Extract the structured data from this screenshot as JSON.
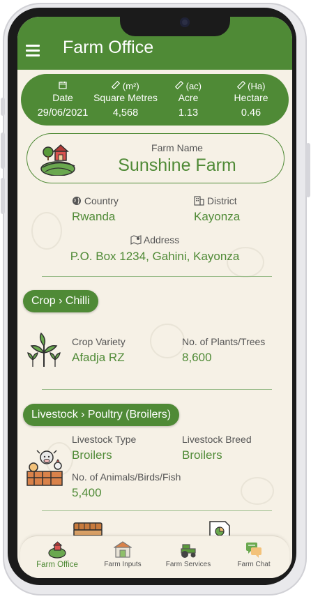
{
  "app": {
    "title": "Farm Office"
  },
  "stats": [
    {
      "icon": "calendar-icon",
      "unit": "",
      "label": "Date",
      "value": "29/06/2021"
    },
    {
      "icon": "ruler-icon",
      "unit": "(m²)",
      "label": "Square Metres",
      "value": "4,568"
    },
    {
      "icon": "ruler-icon",
      "unit": "(ac)",
      "label": "Acre",
      "value": "1.13"
    },
    {
      "icon": "ruler-icon",
      "unit": "(Ha)",
      "label": "Hectare",
      "value": "0.46"
    }
  ],
  "farm": {
    "name_label": "Farm Name",
    "name": "Sunshine Farm"
  },
  "location": {
    "country_label": "Country",
    "country": "Rwanda",
    "district_label": "District",
    "district": "Kayonza",
    "address_label": "Address",
    "address": "P.O. Box 1234, Gahini, Kayonza"
  },
  "crop": {
    "section": "Crop › Chilli",
    "variety_label": "Crop Variety",
    "variety": "Afadja RZ",
    "plants_label": "No. of Plants/Trees",
    "plants": "8,600"
  },
  "livestock": {
    "section": "Livestock › Poultry (Broilers)",
    "type_label": "Livestock Type",
    "type": "Broilers",
    "breed_label": "Livestock Breed",
    "breed": "Broilers",
    "count_label": "No. of Animals/Birds/Fish",
    "count": "5,400"
  },
  "nav": [
    {
      "label": "Farm Office",
      "icon": "farm-office-icon",
      "active": true
    },
    {
      "label": "Farm Inputs",
      "icon": "farm-inputs-icon",
      "active": false
    },
    {
      "label": "Farm Services",
      "icon": "tractor-icon",
      "active": false
    },
    {
      "label": "Farm Chat",
      "icon": "chat-icon",
      "active": false
    }
  ],
  "colors": {
    "primary": "#4f8a36",
    "background": "#f6f1e6"
  }
}
